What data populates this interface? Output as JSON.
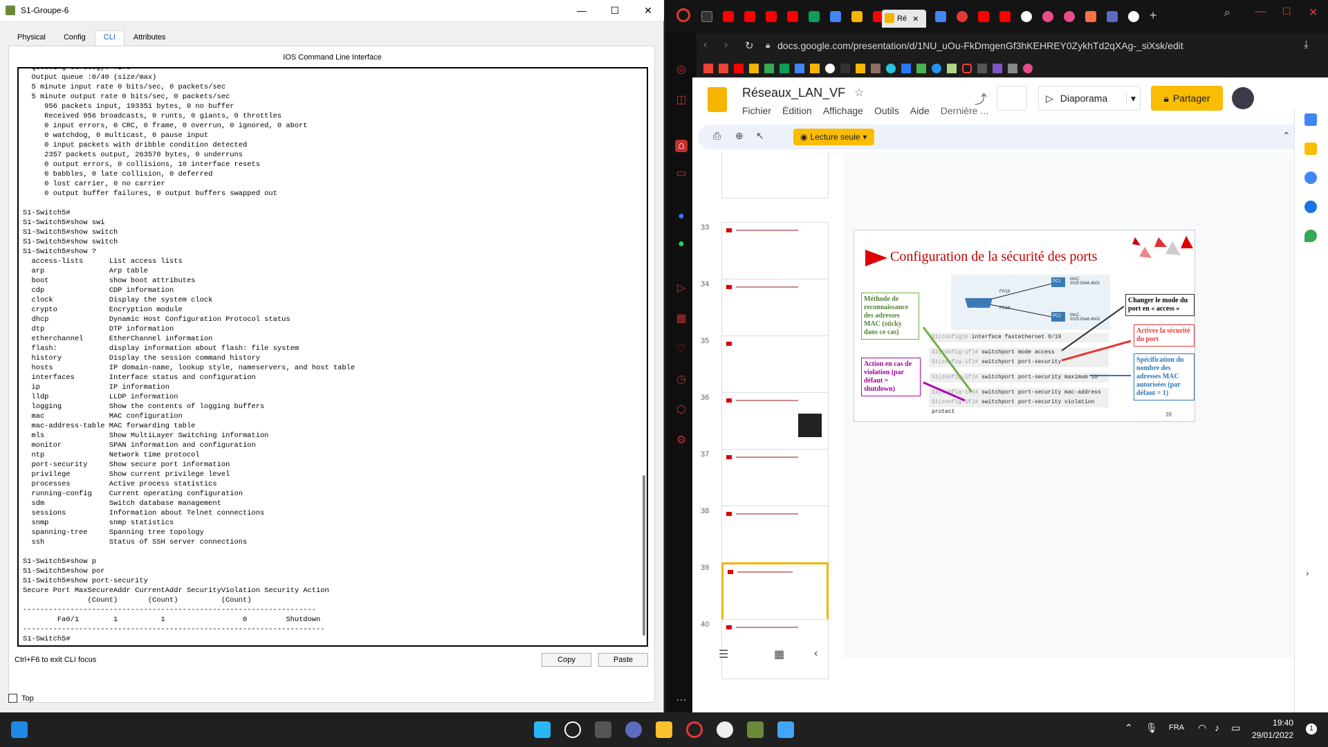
{
  "pt": {
    "title": "S1-Groupe-6",
    "tabs": [
      "Physical",
      "Config",
      "CLI",
      "Attributes"
    ],
    "cli_header": "IOS Command Line Interface",
    "cli_text": "  Queueing strategy: fifo\n  Output queue :0/40 (size/max)\n  5 minute input rate 0 bits/sec, 0 packets/sec\n  5 minute output rate 0 bits/sec, 0 packets/sec\n     956 packets input, 193351 bytes, 0 no buffer\n     Received 956 broadcasts, 0 runts, 0 giants, 0 throttles\n     0 input errors, 0 CRC, 0 frame, 0 overrun, 0 ignored, 0 abort\n     0 watchdog, 0 multicast, 0 pause input\n     0 input packets with dribble condition detected\n     2357 packets output, 263570 bytes, 0 underruns\n     0 output errors, 0 collisions, 10 interface resets\n     0 babbles, 0 late collision, 0 deferred\n     0 lost carrier, 0 no carrier\n     0 output buffer failures, 0 output buffers swapped out\n\nS1-Switch5#\nS1-Switch5#show swi\nS1-Switch5#show switch\nS1-Switch5#show switch\nS1-Switch5#show ?\n  access-lists      List access lists\n  arp               Arp table\n  boot              show boot attributes\n  cdp               CDP information\n  clock             Display the system clock\n  crypto            Encryption module\n  dhcp              Dynamic Host Configuration Protocol status\n  dtp               DTP information\n  etherchannel      EtherChannel information\n  flash:            display information about flash: file system\n  history           Display the session command history\n  hosts             IP domain-name, lookup style, nameservers, and host table\n  interfaces        Interface status and configuration\n  ip                IP information\n  lldp              LLDP information\n  logging           Show the contents of logging buffers\n  mac               MAC configuration\n  mac-address-table MAC forwarding table\n  mls               Show MultiLayer Switching information\n  monitor           SPAN information and configuration\n  ntp               Network time protocol\n  port-security     Show secure port information\n  privilege         Show current privilege level\n  processes         Active process statistics\n  running-config    Current operating configuration\n  sdm               Switch database management\n  sessions          Information about Telnet connections\n  snmp              snmp statistics\n  spanning-tree     Spanning tree topology\n  ssh               Status of SSH server connections\n\nS1-Switch5#show p\nS1-Switch5#show por\nS1-Switch5#show port-security\nSecure Port MaxSecureAddr CurrentAddr SecurityViolation Security Action\n               (Count)       (Count)          (Count)\n--------------------------------------------------------------------\n        Fa0/1        1          1                  0         Shutdown\n----------------------------------------------------------------------\nS1-Switch5#",
    "hint": "Ctrl+F6 to exit CLI focus",
    "copy": "Copy",
    "paste": "Paste",
    "top": "Top"
  },
  "browser": {
    "active_tab": "Ré",
    "url": "docs.google.com/presentation/d/1NU_uOu-FkDmgenGf3hKEHREY0ZykhTd2qXAg-_siXsk/edit"
  },
  "slides": {
    "title": "Réseaux_LAN_VF",
    "menus": [
      "Fichier",
      "Édition",
      "Affichage",
      "Outils",
      "Aide",
      "Dernière ..."
    ],
    "diaporama": "Diaporama",
    "share": "Partager",
    "lecture": "Lecture seule",
    "thumb_numbers": [
      "33",
      "34",
      "35",
      "36",
      "37",
      "38",
      "39",
      "40"
    ],
    "slide": {
      "title": "Configuration de la sécurité des ports",
      "num": "39",
      "f018": "F0/18",
      "f019": "F0/19",
      "s1": "S1",
      "pc1": "PC1",
      "pc2": "PC2",
      "mac1": "MAC:\n0025.83e6.4b01",
      "mac2": "MAC:\n0025.83e6.4b02",
      "cmd": [
        "interface fastethernet 0/19",
        "switchport mode access",
        "switchport port-security",
        "switchport port-security maximum 10",
        "switchport port-security mac-address sticky",
        "switchport port-security violation protect"
      ],
      "prompt1": "S1(config)#",
      "prompt2": "S1(config-if)#",
      "note_green": "Méthode de reconnaissance des adresses MAC (sticky dans ce cas)",
      "note_purple": "Action en cas de violation (par défaut = shutdown)",
      "note_black": "Changer le mode du port en « access »",
      "note_red": "Activer la sécurité du port",
      "note_blue": "Spécification du nombre des adresses MAC autorisées (par défaut = 1)"
    }
  },
  "taskbar": {
    "lang": "FRA",
    "time": "19:40",
    "date": "29/01/2022"
  }
}
